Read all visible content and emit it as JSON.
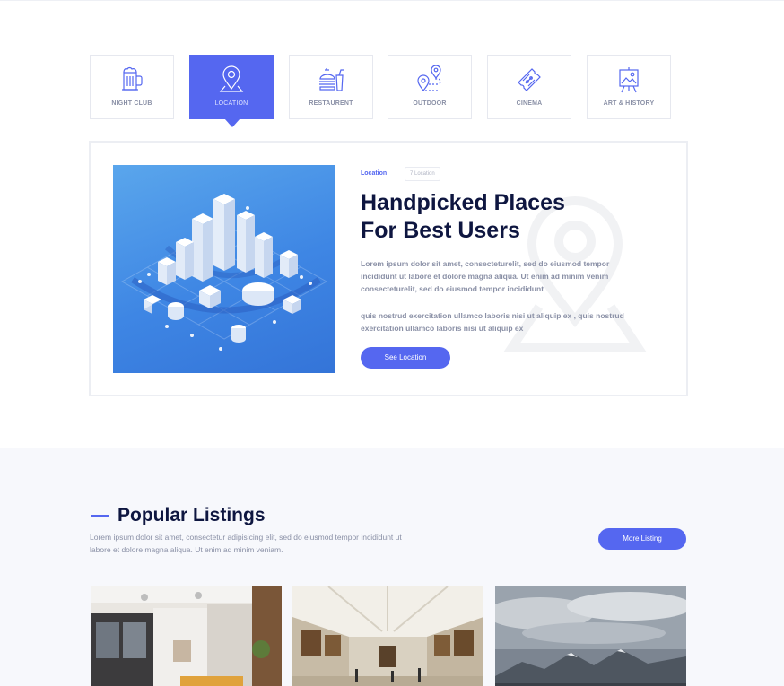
{
  "categories": [
    {
      "label": "NIGHT CLUB",
      "icon": "beer-mug-icon",
      "active": false
    },
    {
      "label": "LOCATION",
      "icon": "map-pin-icon",
      "active": true
    },
    {
      "label": "RESTAURENT",
      "icon": "burger-drink-icon",
      "active": false
    },
    {
      "label": "OUTDOOR",
      "icon": "route-pin-icon",
      "active": false
    },
    {
      "label": "CINEMA",
      "icon": "ticket-icon",
      "active": false
    },
    {
      "label": "ART & HISTORY",
      "icon": "easel-painting-icon",
      "active": false
    }
  ],
  "feature": {
    "tag": "Location",
    "count": "7 Location",
    "headline_line1": "Handpicked Places",
    "headline_line2": "For Best Users",
    "paragraph1": "Lorem ipsum dolor sit amet, consecteturelit, sed do eiusmod tempor incididunt ut labore et dolore magna aliqua. Ut enim ad minim venim consecteturelit, sed do eiusmod tempor incididunt",
    "paragraph2": "quis nostrud exercitation ullamco laboris nisi ut aliquip ex , quis nostrud exercitation ullamco laboris nisi ut aliquip ex",
    "cta_label": "See Location",
    "image_icon": "isometric-city-illustration",
    "watermark_icon": "map-pin-icon"
  },
  "listings": {
    "title": "Popular Listings",
    "description": "Lorem ipsum dolor sit amet, consectetur adipisicing elit, sed do eiusmod tempor incididunt ut labore et dolore magna aliqua. Ut enim ad minim veniam.",
    "more_label": "More Listing",
    "photos": [
      "restaurant-interior-photo",
      "art-gallery-photo",
      "mountain-landscape-photo"
    ]
  },
  "colors": {
    "accent": "#5567f0",
    "heading": "#0e1640",
    "body_text": "#8a90a6",
    "section_bg": "#f7f8fc"
  }
}
